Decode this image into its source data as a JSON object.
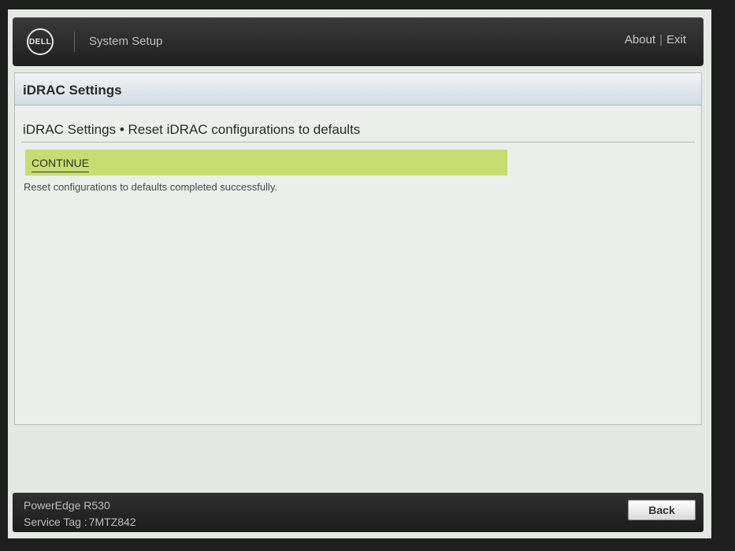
{
  "header": {
    "logo_text": "DELL",
    "app_title": "System Setup",
    "about_label": "About",
    "separator": "|",
    "exit_label": "Exit"
  },
  "panel": {
    "title": "iDRAC Settings",
    "breadcrumb": "iDRAC Settings • Reset iDRAC configurations to defaults",
    "continue_label": "CONTINUE",
    "status_message": "Reset configurations to defaults completed successfully.",
    "highlight_color": "#c9dc6f"
  },
  "footer": {
    "model": "PowerEdge R530",
    "service_tag_label": "Service Tag :",
    "service_tag_value": "7MTZ842",
    "back_label": "Back"
  }
}
